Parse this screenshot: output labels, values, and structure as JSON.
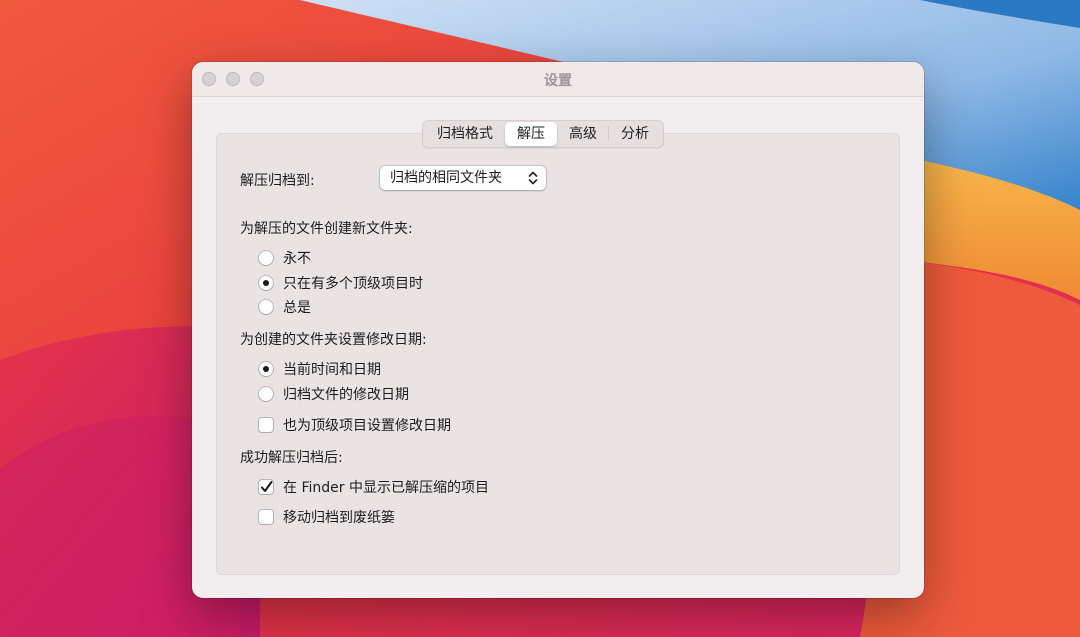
{
  "window": {
    "title": "设置"
  },
  "tabs": [
    {
      "label": "归档格式",
      "active": false
    },
    {
      "label": "解压",
      "active": true
    },
    {
      "label": "高级",
      "active": false
    },
    {
      "label": "分析",
      "active": false
    }
  ],
  "extract": {
    "destination_label": "解压归档到:",
    "destination_value": "归档的相同文件夹"
  },
  "new_folder": {
    "heading": "为解压的文件创建新文件夹:",
    "options": [
      {
        "label": "永不",
        "selected": false
      },
      {
        "label": "只在有多个顶级项目时",
        "selected": true
      },
      {
        "label": "总是",
        "selected": false
      }
    ]
  },
  "mod_date": {
    "heading": "为创建的文件夹设置修改日期:",
    "options": [
      {
        "label": "当前时间和日期",
        "selected": true
      },
      {
        "label": "归档文件的修改日期",
        "selected": false
      }
    ],
    "also_top_level": {
      "label": "也为顶级项目设置修改日期",
      "checked": false
    }
  },
  "after_success": {
    "heading": "成功解压归档后:",
    "reveal_in_finder": {
      "label": "在 Finder 中显示已解压缩的项目",
      "checked": true
    },
    "move_to_trash": {
      "label": "移动归档到废纸篓",
      "checked": false
    }
  },
  "icons": {
    "popup_chevron": "chevron-up-down-icon",
    "checkmark": "checkmark-icon"
  },
  "colors": {
    "window_bg": "#f2edee",
    "panel_bg": "#e9e3e4",
    "wallpaper_red": "#e8383e",
    "wallpaper_blue": "#2a7cc7",
    "wallpaper_orange": "#f6a63a"
  }
}
